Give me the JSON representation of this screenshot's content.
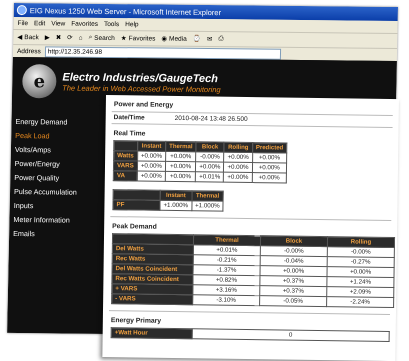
{
  "browser": {
    "title": "EIG Nexus 1250 Web Server - Microsoft Internet Explorer",
    "menu": [
      "File",
      "Edit",
      "View",
      "Favorites",
      "Tools",
      "Help"
    ],
    "toolbar": {
      "back": "Back",
      "search": "Search",
      "favorites": "Favorites",
      "media": "Media"
    },
    "address_label": "Address",
    "address_value": "http://12.35.246.98"
  },
  "brand": {
    "logo_letter": "e",
    "name": "Electro Industries/GaugeTech",
    "tagline": "The Leader in Web Accessed Power Monitoring"
  },
  "sidebar": {
    "items": [
      "Energy Demand",
      "Peak Load",
      "Volts/Amps",
      "Power/Energy",
      "Power Quality",
      "Pulse Accumulation",
      "Inputs",
      "Meter Information",
      "Emails"
    ],
    "active_index": 1
  },
  "sheet": {
    "title": "Power and Energy",
    "datetime_label": "Date/Time",
    "datetime_value": "2010-08-24  13:48 26.500",
    "realtime": {
      "title": "Real Time",
      "headers": [
        "",
        "Instant",
        "Thermal",
        "Block",
        "Rolling",
        "Predicted"
      ],
      "rows": [
        [
          "Watts",
          "+0.00%",
          "+0.00%",
          "-0.00%",
          "+0.00%",
          "+0.00%"
        ],
        [
          "VARS",
          "+0.00%",
          "+0.00%",
          "+0.00%",
          "+0.00%",
          "+0.00%"
        ],
        [
          "VA",
          "+0.00%",
          "+0.00%",
          "+0.01%",
          "+0.00%",
          "+0.00%"
        ]
      ]
    },
    "pf": {
      "headers": [
        "",
        "Instant",
        "Thermal"
      ],
      "row": [
        "PF",
        "+1.000%",
        "+1.000%"
      ]
    },
    "peak": {
      "title": "Peak Demand",
      "headers": [
        "",
        "Thermal",
        "Block",
        "Rolling"
      ],
      "rows": [
        [
          "Del Watts",
          "+0.01%",
          "-0.00%",
          "-0.00%"
        ],
        [
          "Rec Watts",
          "-0.21%",
          "-0.04%",
          "-0.27%"
        ],
        [
          "Del Watts Coincident",
          "-1.37%",
          "+0.00%",
          "+0.00%"
        ],
        [
          "Rec Watts Coincident",
          "+0.82%",
          "+0.37%",
          "+1.24%"
        ],
        [
          "+ VARS",
          "+3.16%",
          "+0.37%",
          "+2.09%"
        ],
        [
          "- VARS",
          "-3.10%",
          "-0.05%",
          "-2.24%"
        ]
      ]
    },
    "energy": {
      "title": "Energy Primary",
      "row": [
        "+Watt Hour",
        "0"
      ]
    }
  }
}
